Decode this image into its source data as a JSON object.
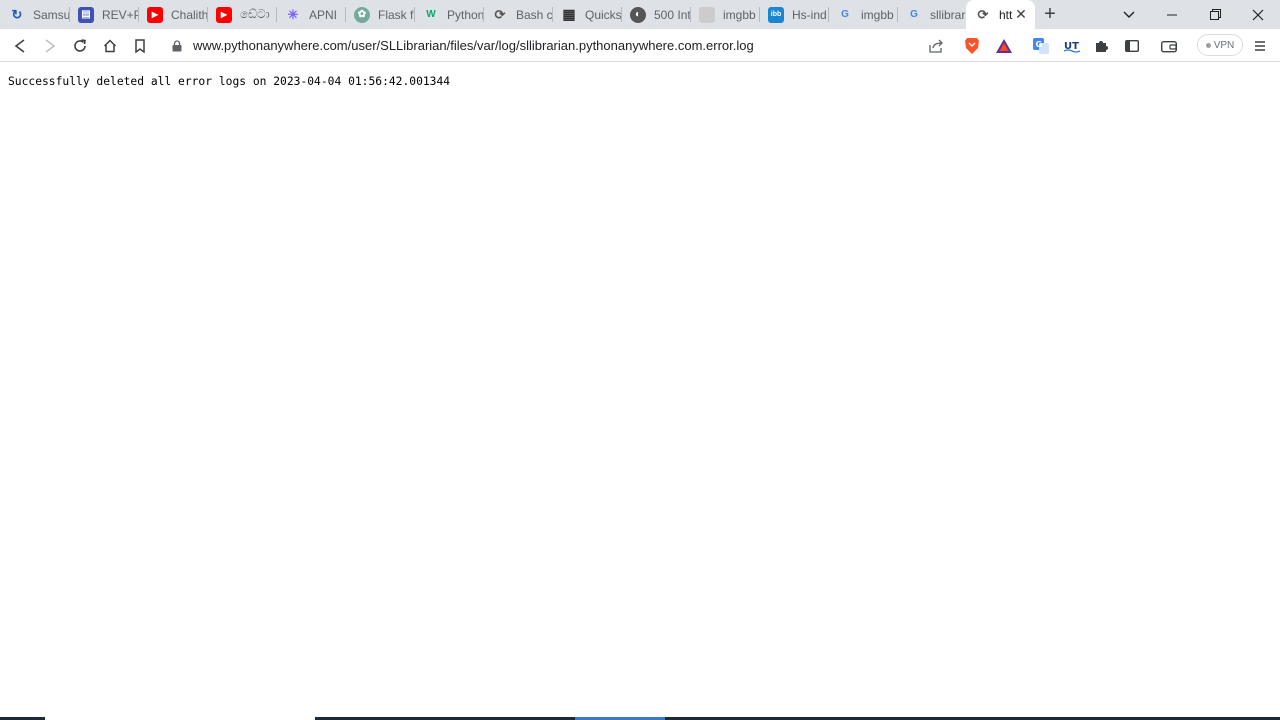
{
  "tabs": [
    {
      "title": "Samsu",
      "icon": "samsung-icon",
      "color": "#1e5bb8"
    },
    {
      "title": "REV+P",
      "icon": "rev-form-icon",
      "color": "#3f51b5"
    },
    {
      "title": "Chalith",
      "icon": "youtube-icon",
      "color": "#ff0000"
    },
    {
      "title": "ඩේටා",
      "icon": "youtube-icon",
      "color": "#ff0000"
    },
    {
      "title": "APNI",
      "icon": "apni-icon",
      "color": "#7b61ff"
    },
    {
      "title": "Flask fi",
      "icon": "chatgpt-icon",
      "color": "#74aa9c"
    },
    {
      "title": "Python",
      "icon": "w3schools-icon",
      "color": "#04aa6d"
    },
    {
      "title": "Bash c",
      "icon": "pythonanywhere-icon",
      "color": "#555555"
    },
    {
      "title": "Quicks",
      "icon": "docs-icon",
      "color": "#333333"
    },
    {
      "title": "500 Int",
      "icon": "globe-icon",
      "color": "#555555"
    },
    {
      "title": "imgbb",
      "icon": "blank-page-icon",
      "color": "#cccccc"
    },
    {
      "title": "Hs-ind",
      "icon": "ibb-icon",
      "color": "#1a86d0"
    },
    {
      "title": "imgbb",
      "icon": "google-icon",
      "color": "#4285f4"
    },
    {
      "title": "sllibrar",
      "icon": "google-icon",
      "color": "#4285f4"
    },
    {
      "title": "htt",
      "icon": "pythonanywhere-icon",
      "color": "#555555",
      "active": true
    }
  ],
  "address": {
    "url": "www.pythonanywhere.com/user/SLLibrarian/files/var/log/sllibrarian.pythonanywhere.com.error.log"
  },
  "vpn_label": "VPN",
  "page": {
    "text": "Successfully deleted all error logs on 2023-04-04 01:56:42.001344"
  }
}
